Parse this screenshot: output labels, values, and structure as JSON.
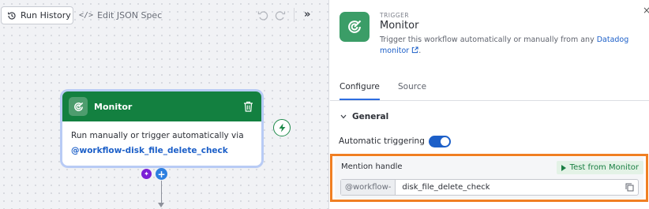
{
  "toolbar": {
    "run_history_label": "Run History",
    "edit_json_label": "Edit JSON Spec",
    "edit_json_glyph": "</>"
  },
  "node": {
    "title": "Monitor",
    "body_text": "Run manually or trigger automatically via",
    "handle_text": "@workflow-disk_file_delete_check",
    "icon": "monitor-trigger-icon"
  },
  "panel": {
    "eyebrow": "TRIGGER",
    "title": "Monitor",
    "desc_text": "Trigger this workflow automatically or manually from any ",
    "desc_link": "Datadog monitor",
    "desc_suffix": ".",
    "tabs": [
      {
        "label": "Configure",
        "active": true
      },
      {
        "label": "Source",
        "active": false
      }
    ],
    "section_title": "General",
    "auto_trigger_label": "Automatic triggering",
    "auto_trigger_on": true,
    "mention": {
      "label": "Mention handle",
      "test_button": "Test from Monitor",
      "prefix": "@workflow-",
      "value": "disk_file_delete_check"
    }
  },
  "colors": {
    "node_header": "#138040",
    "accent_blue": "#1c5fc8",
    "highlight_orange": "#f07f23",
    "test_green": "#1a7f43"
  }
}
